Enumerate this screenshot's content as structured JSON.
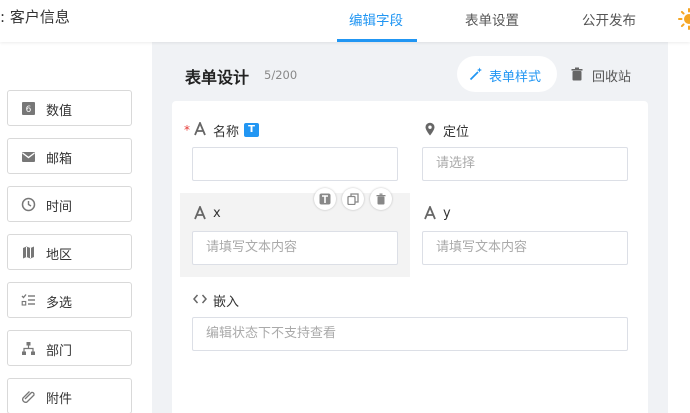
{
  "header": {
    "app_title": ": 客户信息",
    "tabs": [
      {
        "label": "编辑字段",
        "active": true
      },
      {
        "label": "表单设置",
        "active": false
      },
      {
        "label": "公开发布",
        "active": false
      }
    ]
  },
  "palette": {
    "items": [
      {
        "label": "数值",
        "icon": "number-icon"
      },
      {
        "label": "邮箱",
        "icon": "mail-icon"
      },
      {
        "label": "时间",
        "icon": "clock-icon"
      },
      {
        "label": "地区",
        "icon": "map-icon"
      },
      {
        "label": "多选",
        "icon": "checklist-icon"
      },
      {
        "label": "部门",
        "icon": "org-tree-icon"
      },
      {
        "label": "附件",
        "icon": "paperclip-icon"
      }
    ]
  },
  "designer": {
    "title": "表单设计",
    "count": "5/200",
    "style_button": "表单样式",
    "recycle_button": "回收站"
  },
  "fields": {
    "name": {
      "label": "名称",
      "required": "*",
      "badge": "T",
      "value": ""
    },
    "location": {
      "label": "定位",
      "placeholder": "请选择"
    },
    "x": {
      "label": "x",
      "placeholder": "请填写文本内容"
    },
    "y": {
      "label": "y",
      "placeholder": "请填写文本内容"
    },
    "embed": {
      "label": "嵌入",
      "placeholder": "编辑状态下不支持查看"
    }
  },
  "colors": {
    "accent": "#2196f3",
    "required": "#e53935",
    "sun": "#f5a623"
  }
}
